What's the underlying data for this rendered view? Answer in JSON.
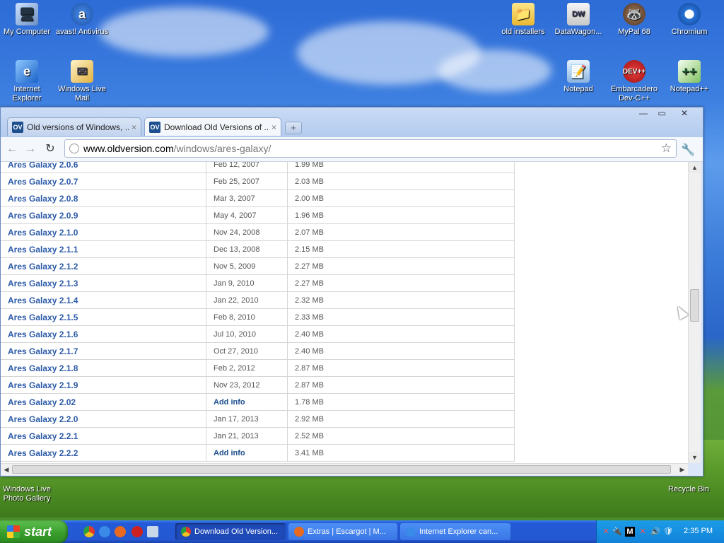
{
  "desktop": {
    "icons": [
      {
        "label": "My Computer",
        "glyph": "🖥"
      },
      {
        "label": "avast! Antivirus",
        "glyph": "a"
      },
      {
        "label": "Internet Explorer",
        "glyph": "e"
      },
      {
        "label": "Windows Live Mail",
        "glyph": "✉"
      },
      {
        "label": "old installers",
        "glyph": "📁"
      },
      {
        "label": "DataWagon...",
        "glyph": "DW"
      },
      {
        "label": "MyPal 68",
        "glyph": "🦝"
      },
      {
        "label": "Chromium",
        "glyph": ""
      },
      {
        "label": "Notepad",
        "glyph": "📝"
      },
      {
        "label": "Embarcadero Dev-C++",
        "glyph": "DEV++"
      },
      {
        "label": "Notepad++",
        "glyph": "++"
      },
      {
        "label": "Windows Live Photo Gallery",
        "glyph": "🖼"
      },
      {
        "label": "Recycle Bin",
        "glyph": "♻"
      }
    ]
  },
  "browser": {
    "tabs": [
      {
        "favicon": "OV",
        "label": "Old versions of Windows, ...",
        "close": "×"
      },
      {
        "favicon": "OV",
        "label": "Download Old Versions of ...",
        "close": "×"
      }
    ],
    "new_tab": "+",
    "window_buttons": {
      "minimize": "—",
      "maximize": "▭",
      "close": "✕"
    },
    "nav": {
      "back": "←",
      "forward": "→",
      "reload": "↻"
    },
    "url_host": "www.oldversion.com",
    "url_path": "/windows/ares-galaxy/",
    "bookmark_star": "☆",
    "wrench": "🔧"
  },
  "versions": [
    {
      "name": "Ares Galaxy 2.0.6",
      "date": "Feb 12, 2007",
      "size": "1.99 MB"
    },
    {
      "name": "Ares Galaxy 2.0.7",
      "date": "Feb 25, 2007",
      "size": "2.03 MB"
    },
    {
      "name": "Ares Galaxy 2.0.8",
      "date": "Mar 3, 2007",
      "size": "2.00 MB"
    },
    {
      "name": "Ares Galaxy 2.0.9",
      "date": "May 4, 2007",
      "size": "1.96 MB"
    },
    {
      "name": "Ares Galaxy 2.1.0",
      "date": "Nov 24, 2008",
      "size": "2.07 MB"
    },
    {
      "name": "Ares Galaxy 2.1.1",
      "date": "Dec 13, 2008",
      "size": "2.15 MB"
    },
    {
      "name": "Ares Galaxy 2.1.2",
      "date": "Nov 5, 2009",
      "size": "2.27 MB"
    },
    {
      "name": "Ares Galaxy 2.1.3",
      "date": "Jan 9, 2010",
      "size": "2.27 MB"
    },
    {
      "name": "Ares Galaxy 2.1.4",
      "date": "Jan 22, 2010",
      "size": "2.32 MB"
    },
    {
      "name": "Ares Galaxy 2.1.5",
      "date": "Feb 8, 2010",
      "size": "2.33 MB"
    },
    {
      "name": "Ares Galaxy 2.1.6",
      "date": "Jul 10, 2010",
      "size": "2.40 MB"
    },
    {
      "name": "Ares Galaxy 2.1.7",
      "date": "Oct 27, 2010",
      "size": "2.40 MB"
    },
    {
      "name": "Ares Galaxy 2.1.8",
      "date": "Feb 2, 2012",
      "size": "2.87 MB"
    },
    {
      "name": "Ares Galaxy 2.1.9",
      "date": "Nov 23, 2012",
      "size": "2.87 MB"
    },
    {
      "name": "Ares Galaxy 2.02",
      "date": "Add info",
      "size": "1.78 MB",
      "date_is_link": true
    },
    {
      "name": "Ares Galaxy 2.2.0",
      "date": "Jan 17, 2013",
      "size": "2.92 MB"
    },
    {
      "name": "Ares Galaxy 2.2.1",
      "date": "Jan 21, 2013",
      "size": "2.52 MB"
    },
    {
      "name": "Ares Galaxy 2.2.2",
      "date": "Add info",
      "size": "3.41 MB",
      "date_is_link": true
    }
  ],
  "scroll": {
    "up": "▲",
    "down": "▼",
    "left": "◀",
    "right": "▶"
  },
  "taskbar": {
    "start_label": "start",
    "items": [
      {
        "label": "Download Old Version...",
        "active": true,
        "icon_color": "#e8a020"
      },
      {
        "label": "Extras | Escargot | M...",
        "active": false,
        "icon_color": "#e86a20"
      },
      {
        "label": "Internet Explorer can...",
        "active": false,
        "icon_color": "#3a8ae8"
      }
    ],
    "tray_icons": [
      "✕",
      "🔌",
      "M",
      "✕",
      "🔊",
      "🛡"
    ],
    "clock": "2:35 PM"
  }
}
